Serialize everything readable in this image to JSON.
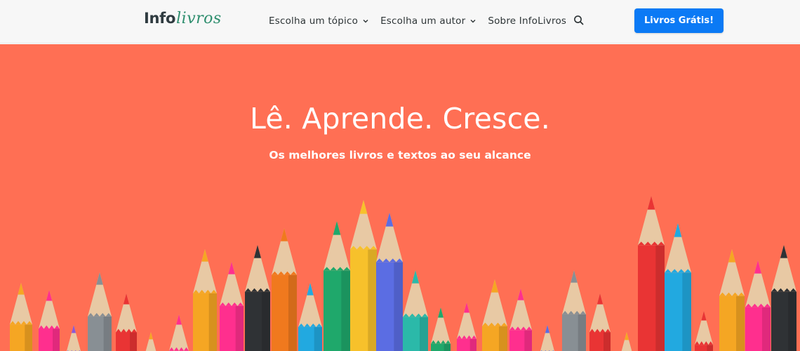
{
  "header": {
    "logo": {
      "part1": "Info",
      "part2": "livros"
    },
    "nav": [
      {
        "label": "Escolha um tópico",
        "has_dropdown": true
      },
      {
        "label": "Escolha um autor",
        "has_dropdown": true
      },
      {
        "label": "Sobre InfoLivros",
        "has_dropdown": false
      }
    ],
    "search_icon": "search-icon",
    "cta_label": "Livros Grátis!",
    "cta_color": "#0b7af5"
  },
  "hero": {
    "title": "Lê. Aprende. Cresce.",
    "subtitle": "Os melhores livros e textos ao seu alcance",
    "background": "#ff6f54",
    "pencil_colors": [
      "#f5a623",
      "#ff2f8e",
      "#2f3235",
      "#f0791e",
      "#22a9e0",
      "#1fa86b",
      "#f7c12b",
      "#5b6de3",
      "#2bb9a9",
      "#e93434",
      "#888f94",
      "#8b58d6"
    ]
  }
}
